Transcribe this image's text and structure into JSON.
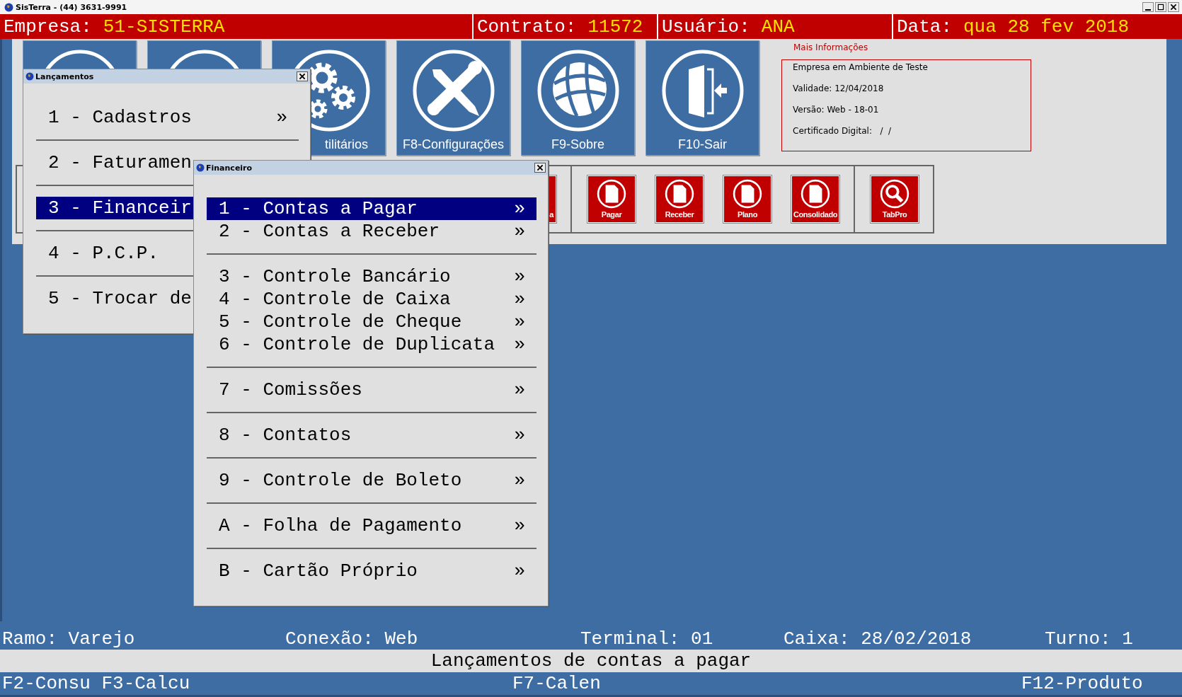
{
  "window": {
    "title": "SisTerra - (44) 3631-9991"
  },
  "header": [
    {
      "label": "Empresa:",
      "value": "51-SISTERRA"
    },
    {
      "label": "Contrato:",
      "value": "11572"
    },
    {
      "label": "Usuário:",
      "value": "ANA"
    },
    {
      "label": "Data:",
      "value": "qua 28 fev 2018"
    }
  ],
  "tiles": [
    {
      "kind": "circle"
    },
    {
      "kind": "circle"
    },
    {
      "kind": "gears",
      "label": "tilitários"
    },
    {
      "kind": "tools",
      "label": "F8-Configurações"
    },
    {
      "kind": "globe",
      "label": "F9-Sobre"
    },
    {
      "kind": "door",
      "label": "F10-Sair"
    }
  ],
  "info": {
    "title": "Mais Informações",
    "lines": [
      "Empresa em Ambiente de Teste",
      "Validade: 12/04/2018",
      "Versão: Web - 18-01",
      "Certificado Digital:   /  /"
    ]
  },
  "shortcut_groups": [
    [
      {
        "kind": "plain",
        "label": "a"
      }
    ],
    [
      {
        "kind": "document",
        "label": "Pagar"
      },
      {
        "kind": "document",
        "label": "Receber"
      },
      {
        "kind": "document",
        "label": "Plano"
      },
      {
        "kind": "document",
        "label": "Consolidado"
      }
    ],
    [
      {
        "kind": "search",
        "label": "TabPro"
      }
    ]
  ],
  "windows": [
    {
      "title": "Lançamentos",
      "groups": [
        [
          {
            "text": "1 - Cadastros",
            "arrow": "»",
            "selected": false
          }
        ],
        [
          {
            "text": "2 - Faturamen",
            "selected": false
          }
        ],
        [
          {
            "text": "3 - Financeir",
            "selected": true
          }
        ],
        [
          {
            "text": "4 - P.C.P.",
            "selected": false
          }
        ],
        [
          {
            "text": "5 - Trocar de",
            "selected": false
          }
        ]
      ]
    },
    {
      "title": "Financeiro",
      "groups": [
        [
          {
            "text": "1 - Contas a Pagar",
            "arrow": "»",
            "selected": true
          },
          {
            "text": "2 - Contas a Receber",
            "arrow": "»",
            "selected": false
          }
        ],
        [
          {
            "text": "3 - Controle Bancário",
            "arrow": "»",
            "selected": false
          },
          {
            "text": "4 - Controle de Caixa",
            "arrow": "»",
            "selected": false
          },
          {
            "text": "5 - Controle de Cheque",
            "arrow": "»",
            "selected": false
          },
          {
            "text": "6 - Controle de Duplicata",
            "arrow": "»",
            "selected": false
          }
        ],
        [
          {
            "text": "7 - Comissões",
            "arrow": "»",
            "selected": false
          }
        ],
        [
          {
            "text": "8 - Contatos",
            "arrow": "»",
            "selected": false
          }
        ],
        [
          {
            "text": "9 - Controle de Boleto",
            "arrow": "»",
            "selected": false
          }
        ],
        [
          {
            "text": "A - Folha de Pagamento",
            "arrow": "»",
            "selected": false
          }
        ],
        [
          {
            "text": "B - Cartão Próprio",
            "arrow": "»",
            "selected": false
          }
        ]
      ]
    }
  ],
  "status_fields": [
    "Ramo: Varejo",
    "Conexão: Web",
    "Terminal: 01",
    "Caixa: 28/02/2018",
    "Turno: 1"
  ],
  "message": "Lançamentos de contas a pagar",
  "function_keys": [
    "F2-Consu F3-Calcu",
    "F7-Calen",
    "F12-Produto"
  ]
}
